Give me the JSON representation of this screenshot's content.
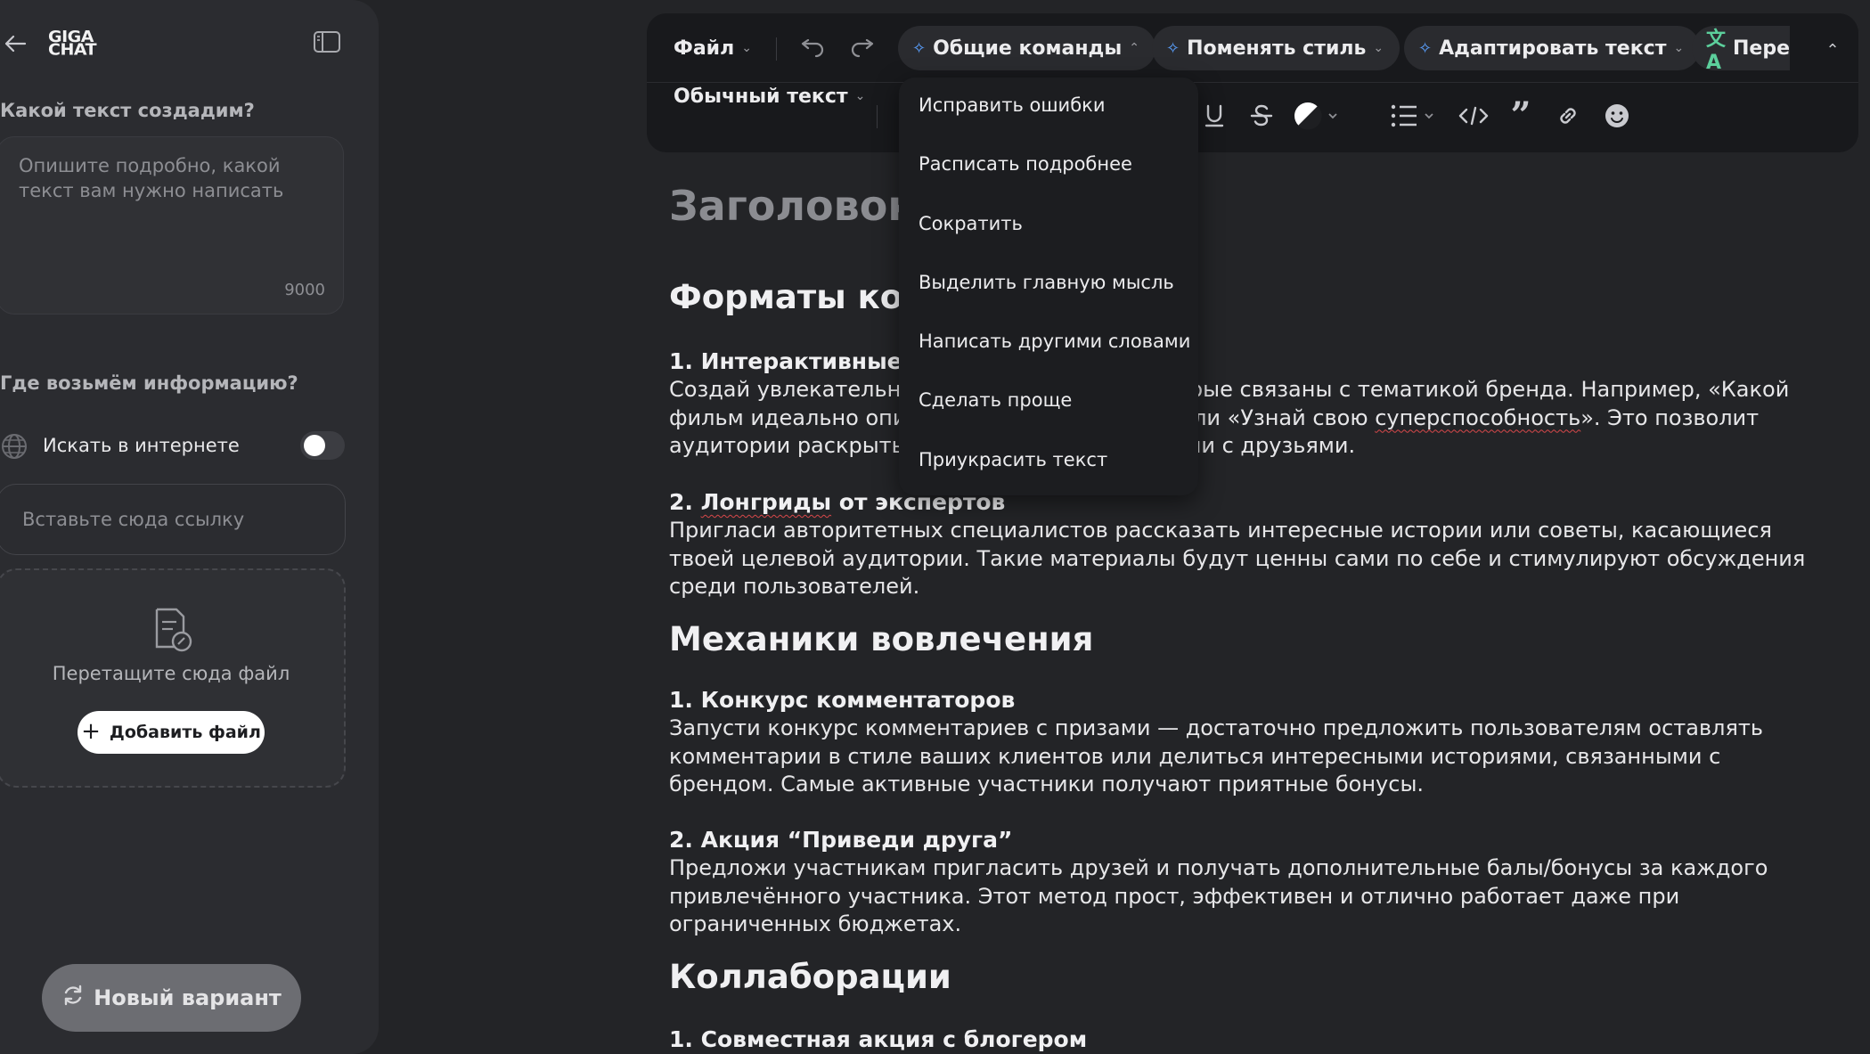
{
  "sidebar": {
    "logo_line1": "GIGA",
    "logo_line2": "CHAT",
    "prompt_section_title": "Какой текст создадим?",
    "prompt_placeholder": "Опишите подробно, какой текст вам нужно написать",
    "prompt_counter": "9000",
    "info_section_title": "Где возьмём информацию?",
    "web_search_label": "Искать в интернете",
    "web_search_enabled": false,
    "link_placeholder": "Вставьте сюда ссылку",
    "drop_label": "Перетащите сюда файл",
    "add_file_label": "Добавить файл",
    "new_variant_label": "Новый вариант"
  },
  "toolbar": {
    "file_label": "Файл",
    "general_commands_label": "Общие команды",
    "change_style_label": "Поменять стиль",
    "adapt_text_label": "Адаптировать текст",
    "translate_label": "Пере",
    "text_style_label": "Обычный текст"
  },
  "dropdown": {
    "items": [
      "Исправить ошибки",
      "Расписать подробнее",
      "Сократить",
      "Выделить главную мысль",
      "Написать другими словами",
      "Сделать проще",
      "Приукрасить текст"
    ]
  },
  "document": {
    "title": "Заголовок",
    "s1_heading": "Форматы конт",
    "s1_item1_heading": "1. Интерактивные о",
    "s1_item1_line1a": "Создай увлекательны",
    "s1_item1_line1b": "торые связаны с тематикой бренда. Например, «Какой",
    "s1_item1_line2a": "фильм идеально опи",
    "s1_item1_line2b": "или «Узнай свою ",
    "s1_item1_line2c": "суперспособность",
    "s1_item1_line2d": "». Это позволит",
    "s1_item1_line3a": "аудитории раскрыть",
    "s1_item1_line3b": "ии с друзьями.",
    "s1_item2_heading_a": "2. ",
    "s1_item2_heading_b": "Лонгриды",
    "s1_item2_heading_c": " от экспертов",
    "s1_item2_text": "Пригласи авторитетных специалистов рассказать интересные истории или советы, касающиеся твоей целевой аудитории. Такие материалы будут ценны сами по себе и стимулируют обсуждения среди пользователей.",
    "s2_heading": "Механики вовлечения",
    "s2_item1_heading": "1. Конкурс комментаторов",
    "s2_item1_text": "Запусти конкурс комментариев с призами — достаточно предложить пользователям оставлять комментарии в стиле ваших клиентов или делиться интересными историями, связанными с брендом. Самые активные участники получают приятные бонусы.",
    "s2_item2_heading": "2. Акция “Приведи друга”",
    "s2_item2_text": "Предложи участникам пригласить друзей и получать дополнительные балы/бонусы за каждого привлечённого участника. Этот метод прост, эффективен и отлично работает даже при ограниченных бюджетах.",
    "s3_heading": "Коллаборации",
    "s3_item1_heading": "1. Совместная акция с блогером"
  },
  "colors": {
    "background": "#232427",
    "sidebar": "#2b2c30",
    "toolbar": "#18191c",
    "accent": "#5aa0ff",
    "spellcheck": "#d8484a"
  }
}
